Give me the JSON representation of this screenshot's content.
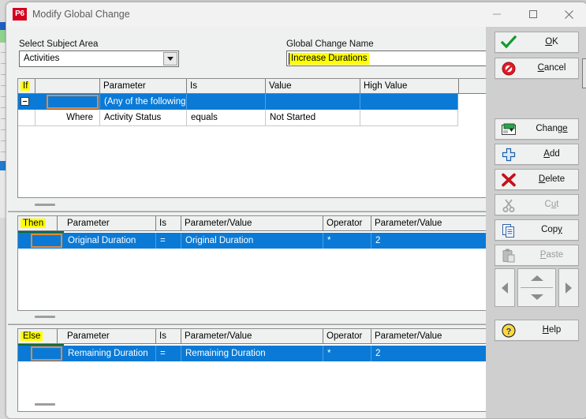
{
  "window": {
    "app_badge": "P6",
    "title": "Modify Global Change",
    "minimize": "minimize-icon",
    "maximize": "maximize-icon",
    "close": "close-icon"
  },
  "form": {
    "subject_area_label": "Select Subject Area",
    "subject_area_value": "Activities",
    "global_change_name_label": "Global Change Name",
    "global_change_name_value": "Increase Durations",
    "highlight_color": "#ffff00",
    "selection_color": "#0a7ad6",
    "focus_color": "#e8883a"
  },
  "if_grid": {
    "columns": [
      "If",
      "",
      "Parameter",
      "Is",
      "Value",
      "High Value",
      ""
    ],
    "rows": [
      {
        "selected": true,
        "expander": true,
        "cells": [
          "",
          "",
          "(Any of the following)",
          "",
          "",
          "",
          ""
        ]
      },
      {
        "selected": false,
        "expander": false,
        "cells": [
          "",
          "Where",
          "Activity Status",
          "equals",
          "Not Started",
          "",
          ""
        ]
      }
    ]
  },
  "then_grid": {
    "columns": [
      "Then",
      "",
      "Parameter",
      "Is",
      "Parameter/Value",
      "Operator",
      "Parameter/Value"
    ],
    "rows": [
      {
        "selected": true,
        "cells": [
          "",
          "",
          "Original Duration",
          "=",
          "Original Duration",
          "*",
          "2"
        ]
      }
    ]
  },
  "else_grid": {
    "columns": [
      "Else",
      "",
      "Parameter",
      "Is",
      "Parameter/Value",
      "Operator",
      "Parameter/Value"
    ],
    "rows": [
      {
        "selected": true,
        "cells": [
          "",
          "",
          "Remaining Duration",
          "=",
          "Remaining Duration",
          "*",
          "2"
        ]
      }
    ]
  },
  "buttons": {
    "ok": "OK",
    "cancel": "Cancel",
    "change": "Change",
    "add": "Add",
    "delete": "Delete",
    "cut": "Cut",
    "copy": "Copy",
    "paste": "Paste",
    "help": "Help"
  }
}
